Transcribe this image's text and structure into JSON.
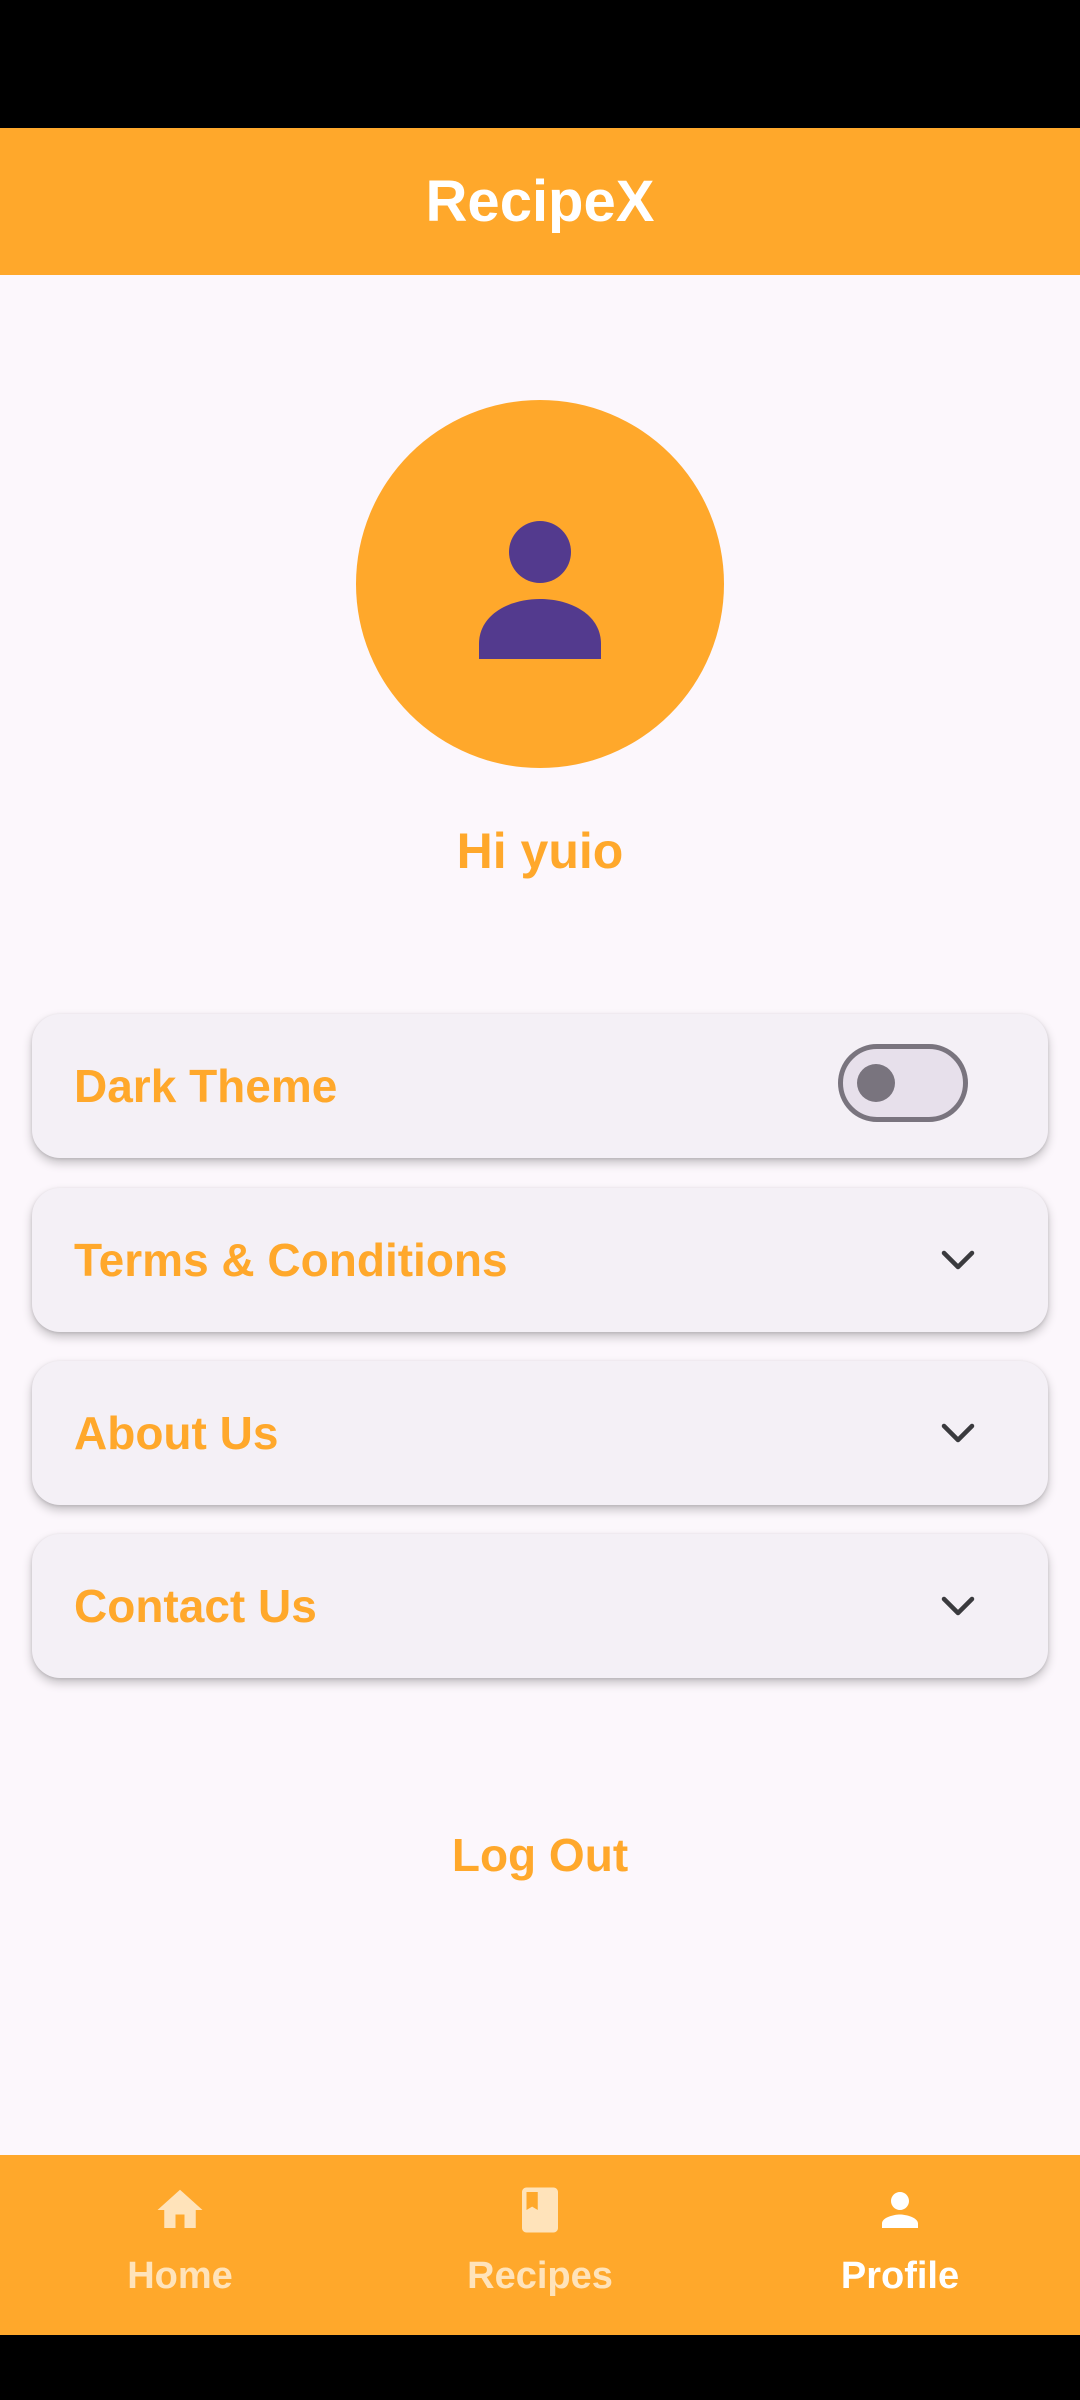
{
  "app": {
    "title": "RecipeX"
  },
  "profile": {
    "greeting": "Hi yuio",
    "avatar_icon": "person-icon"
  },
  "settings": {
    "dark_theme": {
      "label": "Dark Theme",
      "enabled": false
    },
    "sections": [
      {
        "label": "Terms & Conditions",
        "icon": "chevron-down-icon"
      },
      {
        "label": "About Us",
        "icon": "chevron-down-icon"
      },
      {
        "label": "Contact Us",
        "icon": "chevron-down-icon"
      }
    ]
  },
  "logout": {
    "label": "Log Out"
  },
  "nav": {
    "items": [
      {
        "label": "Home",
        "icon": "home-icon"
      },
      {
        "label": "Recipes",
        "icon": "book-icon"
      },
      {
        "label": "Profile",
        "icon": "person-icon",
        "active": true
      }
    ]
  },
  "colors": {
    "accent": "#FFA82B",
    "avatar_figure": "#533A8E",
    "background": "#FCF7FC",
    "card": "#F4F0F6"
  }
}
